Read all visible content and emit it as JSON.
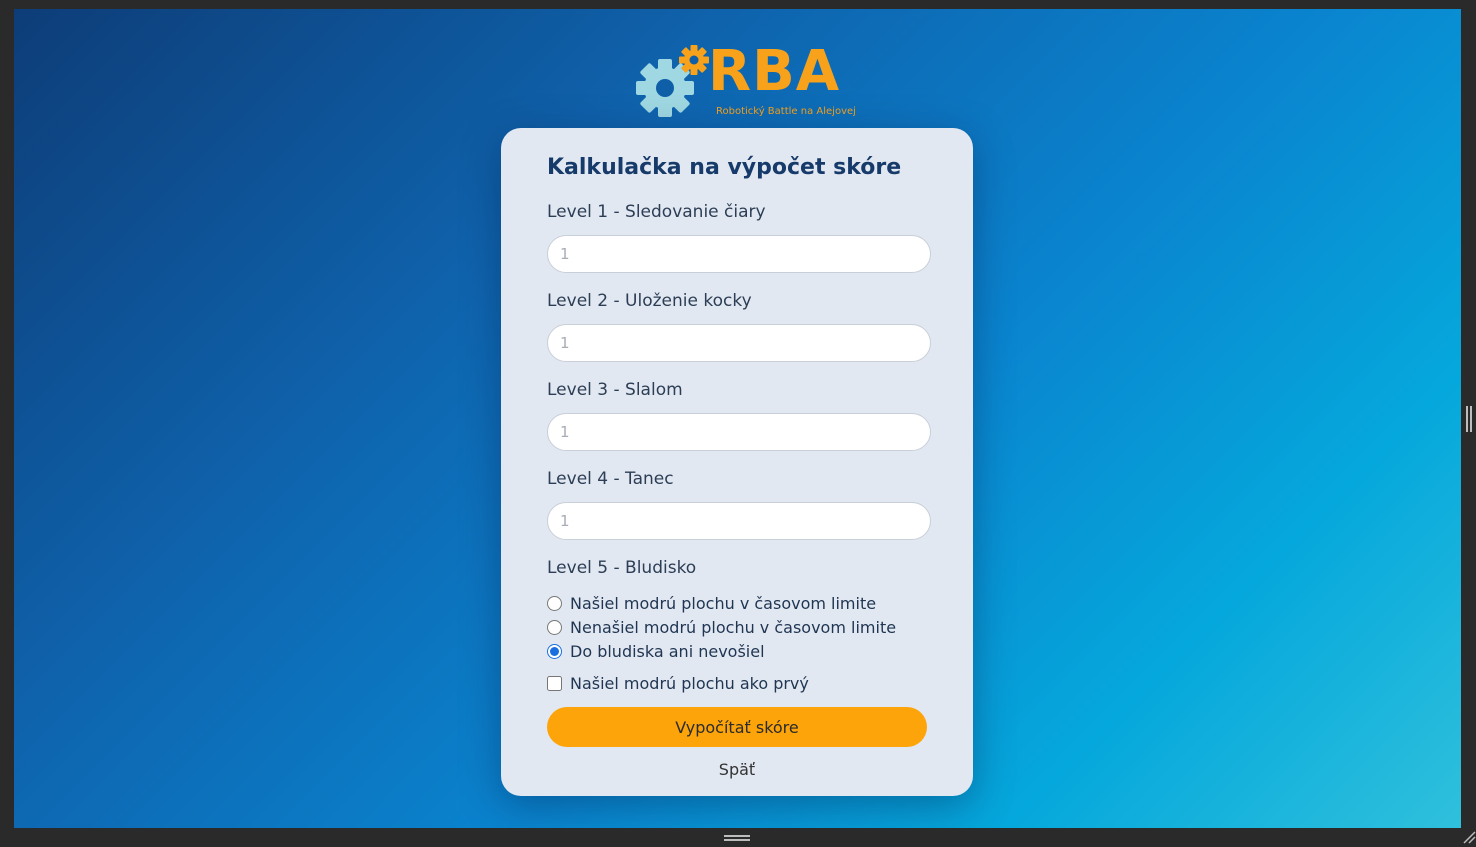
{
  "logo": {
    "text": "RBA",
    "subtitle": "Robotický Battle na Alejovej"
  },
  "calculator": {
    "title": "Kalkulačka na výpočet skóre",
    "levels": [
      {
        "label": "Level 1 - Sledovanie čiary",
        "placeholder": "1",
        "value": ""
      },
      {
        "label": "Level 2 - Uloženie kocky",
        "placeholder": "1",
        "value": ""
      },
      {
        "label": "Level 3 - Slalom",
        "placeholder": "1",
        "value": ""
      },
      {
        "label": "Level 4 - Tanec",
        "placeholder": "1",
        "value": ""
      }
    ],
    "level5": {
      "label": "Level 5 - Bludisko",
      "options": [
        {
          "label": "Našiel modrú plochu v časovom limite",
          "selected": false
        },
        {
          "label": "Nenašiel modrú plochu v časovom limite",
          "selected": false
        },
        {
          "label": "Do bludiska ani nevošiel",
          "selected": true
        }
      ],
      "first_checkbox": {
        "label": "Našiel modrú plochu ako prvý",
        "checked": false
      }
    },
    "submit_label": "Vypočítať skóre",
    "back_label": "Späť"
  },
  "colors": {
    "accent": "#fca40a",
    "logo": "#f7a21a",
    "gear_main": "#9fd8e2",
    "title": "#163a6a",
    "card": "#e2e8f1"
  }
}
